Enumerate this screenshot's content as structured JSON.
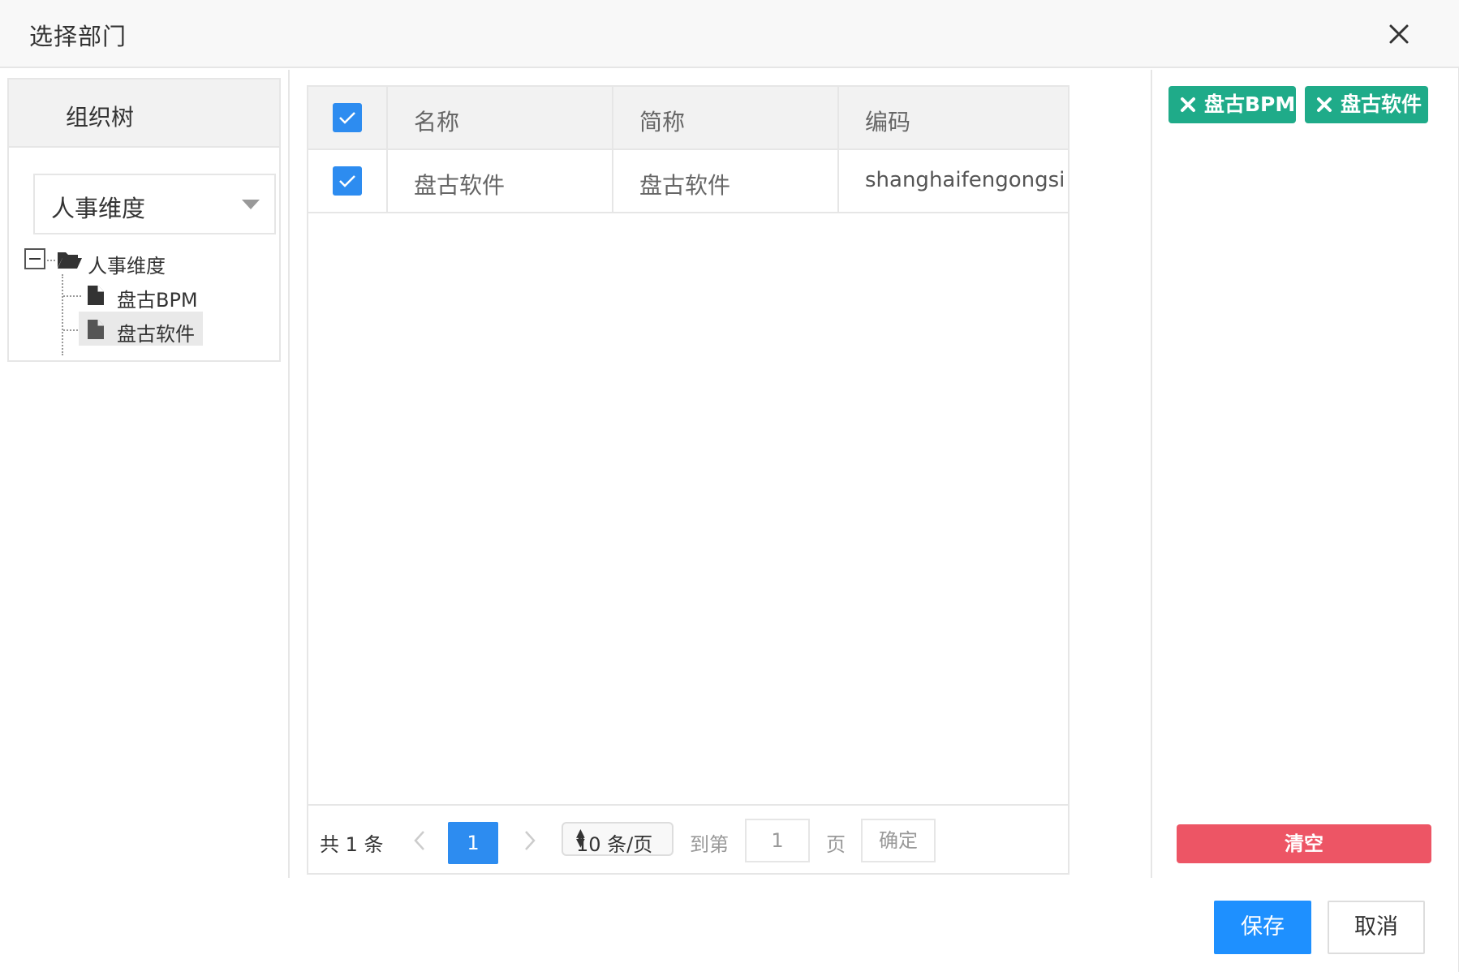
{
  "dialog": {
    "title": "选择部门"
  },
  "tree_panel": {
    "header": "组织树",
    "dimension_select": {
      "value": "人事维度"
    },
    "root": {
      "label": "人事维度",
      "expanded": true
    },
    "children": [
      {
        "label": "盘古BPM",
        "selected": false
      },
      {
        "label": "盘古软件",
        "selected": true
      }
    ]
  },
  "grid": {
    "columns": [
      "名称",
      "简称",
      "编码"
    ],
    "rows": [
      {
        "checked": true,
        "name": "盘古软件",
        "short_name": "盘古软件",
        "code": "shanghaifengongsi"
      }
    ],
    "header_checked": true
  },
  "pager": {
    "total_label": "共 1 条",
    "current_page": "1",
    "page_size": "10 条/页",
    "goto_label": "到第",
    "goto_value": "1",
    "page_suffix": "页",
    "confirm_label": "确定"
  },
  "selected_panel": {
    "tags": [
      "盘古BPM",
      "盘古软件"
    ],
    "clear_label": "清空"
  },
  "footer": {
    "save_label": "保存",
    "cancel_label": "取消"
  },
  "colors": {
    "primary": "#2d8cf0",
    "tag_green": "#1fab89",
    "danger": "#ed5565"
  }
}
